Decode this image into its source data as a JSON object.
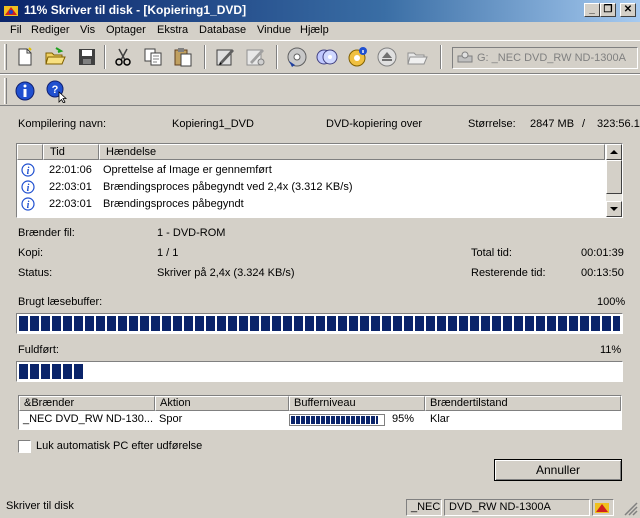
{
  "window": {
    "title": "11% Skriver til disk - [Kopiering1_DVD]",
    "minimize_glyph": "_",
    "restore_glyph": "❐",
    "close_glyph": "✕"
  },
  "menu": {
    "items": [
      "Fil",
      "Rediger",
      "Vis",
      "Optager",
      "Ekstra",
      "Database",
      "Vindue",
      "Hjælp"
    ]
  },
  "toolbar": {
    "icons": [
      "new-document-icon",
      "open-folder-icon",
      "save-disk-icon",
      "cut-icon",
      "copy-icon",
      "paste-icon",
      "burn-compilation-icon",
      "erase-rewritable-icon",
      "disc-info-icon",
      "copy-disc-icon",
      "recorder-info-icon",
      "eject-icon",
      "open-image-icon"
    ],
    "drive": "G: _NEC    DVD_RW ND-1300A"
  },
  "toolbar2": {
    "icons": [
      "about-icon",
      "help-pointer-icon"
    ]
  },
  "compilation": {
    "name_label": "Kompilering navn:",
    "name_value": "Kopiering1_DVD",
    "type_value": "DVD-kopiering over",
    "size_label": "Størrelse:",
    "size_value": "2847 MB",
    "size_separator": "/",
    "size_total": "323:56.1"
  },
  "log": {
    "col_time": "Tid",
    "col_event": "Hændelse",
    "rows": [
      {
        "time": "22:01:06",
        "event": "Oprettelse af Image er gennemført"
      },
      {
        "time": "22:03:01",
        "event": "Brændingsproces påbegyndt ved 2,4x (3.312 KB/s)"
      },
      {
        "time": "22:03:01",
        "event": "Brændingsproces påbegyndt"
      }
    ]
  },
  "details": {
    "file_label": "Brænder fil:",
    "file_value": "1 - DVD-ROM",
    "copy_label": "Kopi:",
    "copy_value": "1 / 1",
    "status_label": "Status:",
    "status_value": "Skriver på 2,4x (3.324 KB/s)",
    "total_time_label": "Total tid:",
    "total_time_value": "00:01:39",
    "remaining_label": "Resterende tid:",
    "remaining_value": "00:13:50"
  },
  "buffer": {
    "label": "Brugt læsebuffer:",
    "percent_text": "100%",
    "fraction": 1.0
  },
  "progress": {
    "label": "Fuldført:",
    "percent_text": "11%",
    "fraction": 0.11
  },
  "recorder_table": {
    "headers": [
      "&Brænder",
      "Aktion",
      "Bufferniveau",
      "Brændertilstand"
    ],
    "row": {
      "recorder": "_NEC DVD_RW ND-130...",
      "action": "Spor",
      "buffer_text": "95%",
      "buffer_fraction": 0.95,
      "state": "Klar"
    }
  },
  "auto_shutdown": {
    "label": "Luk automatisk PC efter udførelse",
    "checked": false
  },
  "buttons": {
    "cancel": "Annuller"
  },
  "statusbar": {
    "text": "Skriver til disk",
    "vendor": "_NEC",
    "model": "DVD_RW ND-1300A"
  }
}
